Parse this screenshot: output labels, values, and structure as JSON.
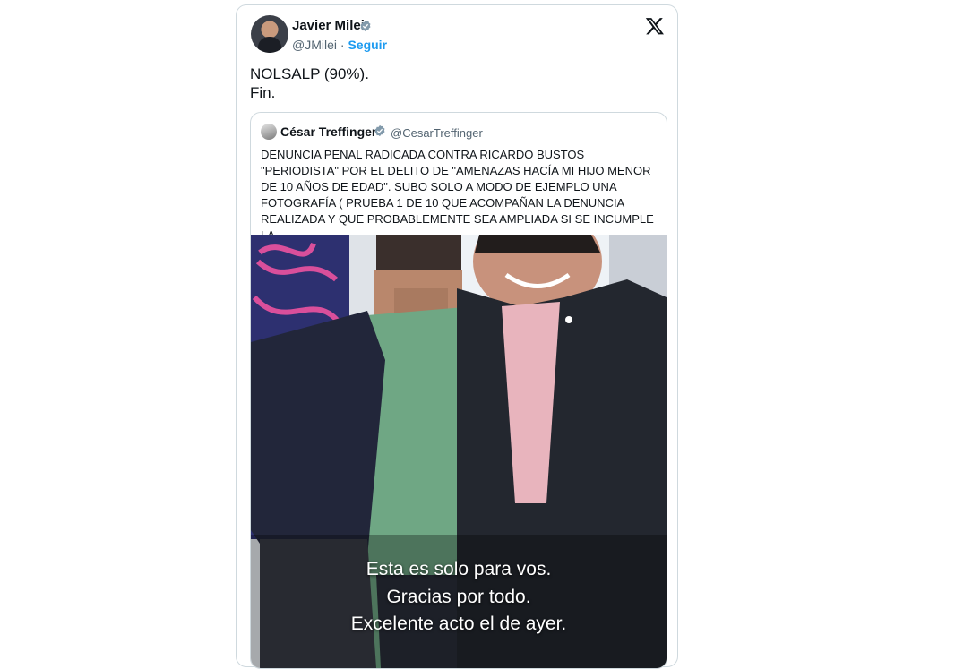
{
  "tweet": {
    "author_name": "Javier Milei",
    "author_handle": "@JMilei",
    "separator": "·",
    "follow_label": "Seguir",
    "text": "NOLSALP (90%).\nFin."
  },
  "quote": {
    "author_name": "César Treffinger",
    "author_handle": "@CesarTreffinger",
    "text": "DENUNCIA PENAL RADICADA CONTRA RICARDO BUSTOS \"PERIODISTA\" POR EL DELITO DE \"AMENAZAS HACÍA MI HIJO MENOR DE 10 AÑOS DE EDAD\". SUBO SOLO A MODO DE EJEMPLO UNA FOTOGRAFÍA ( PRUEBA 1 DE 10 QUE ACOMPAÑAN LA DENUNCIA REALIZADA Y QUE PROBABLEMENTE SEA AMPLIADA SI SE INCUMPLE LA",
    "image_caption": {
      "line1": "Esta es solo para vos.",
      "line2": "Gracias por todo.",
      "line3": "Excelente acto el de ayer."
    }
  },
  "colors": {
    "accent": "#1d9bf0",
    "text": "#0f1419",
    "muted": "#536471",
    "border": "#cfd9de"
  },
  "icons": {
    "brand": "x-logo-icon",
    "verified": "verified-badge-icon"
  }
}
